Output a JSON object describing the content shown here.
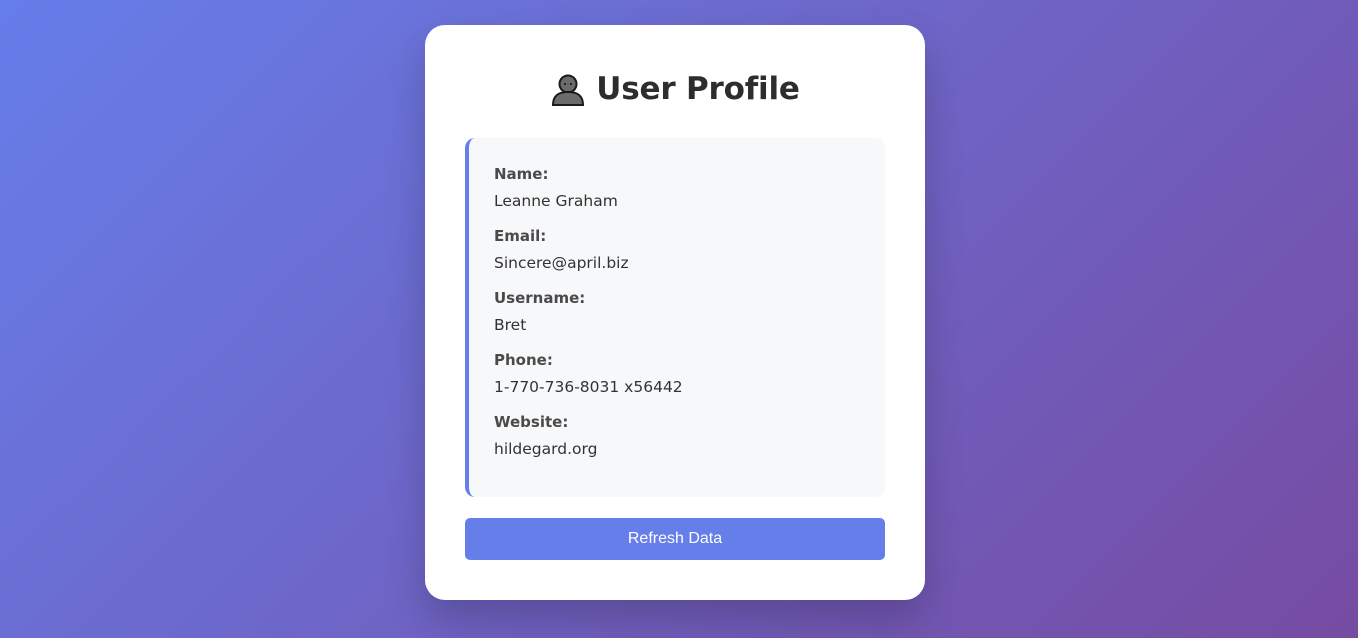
{
  "header": {
    "icon": "bust-in-silhouette-icon",
    "title": "User Profile"
  },
  "profile": {
    "fields": [
      {
        "label": "Name:",
        "value": "Leanne Graham"
      },
      {
        "label": "Email:",
        "value": "Sincere@april.biz"
      },
      {
        "label": "Username:",
        "value": "Bret"
      },
      {
        "label": "Phone:",
        "value": "1-770-736-8031 x56442"
      },
      {
        "label": "Website:",
        "value": "hildegard.org"
      }
    ]
  },
  "actions": {
    "refresh_label": "Refresh Data"
  },
  "colors": {
    "gradient_start": "#667eea",
    "gradient_end": "#764ba2",
    "accent": "#667eea",
    "card_bg": "#ffffff",
    "info_bg": "#f7f8fa"
  }
}
